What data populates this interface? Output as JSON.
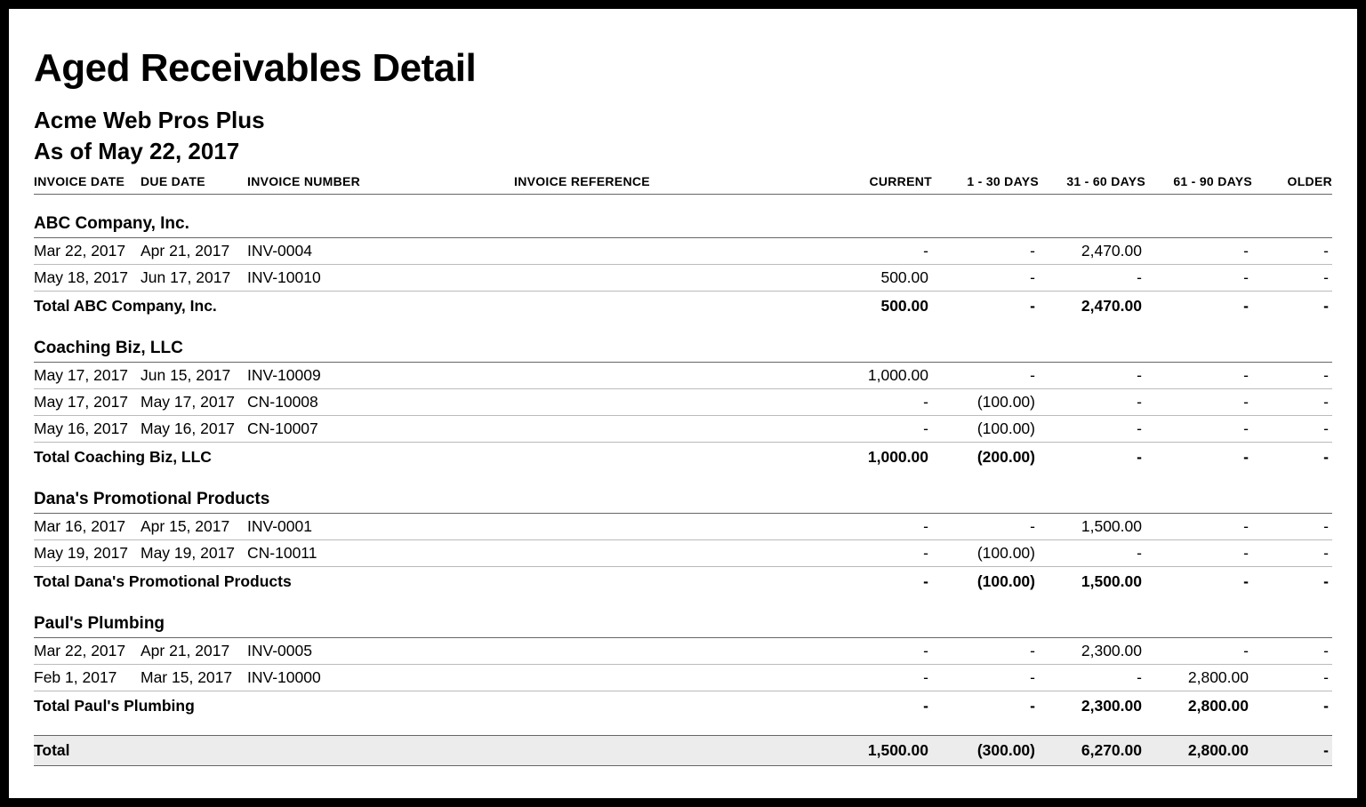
{
  "title": "Aged Receivables Detail",
  "company": "Acme Web Pros Plus",
  "as_of": "As of May 22, 2017",
  "columns": {
    "invoice_date": "INVOICE DATE",
    "due_date": "DUE DATE",
    "invoice_number": "INVOICE NUMBER",
    "invoice_reference": "INVOICE REFERENCE",
    "current": "CURRENT",
    "d1_30": "1 - 30 DAYS",
    "d31_60": "31 - 60 DAYS",
    "d61_90": "61 - 90 DAYS",
    "older": "OLDER"
  },
  "sections": [
    {
      "name": "ABC Company, Inc.",
      "rows": [
        {
          "invoice_date": "Mar 22, 2017",
          "due_date": "Apr 21, 2017",
          "invoice_number": "INV-0004",
          "invoice_reference": "",
          "current": "-",
          "d1_30": "-",
          "d31_60": "2,470.00",
          "d61_90": "-",
          "older": "-"
        },
        {
          "invoice_date": "May 18, 2017",
          "due_date": "Jun 17, 2017",
          "invoice_number": "INV-10010",
          "invoice_reference": "",
          "current": "500.00",
          "d1_30": "-",
          "d31_60": "-",
          "d61_90": "-",
          "older": "-"
        }
      ],
      "total": {
        "label": "Total ABC Company, Inc.",
        "current": "500.00",
        "d1_30": "-",
        "d31_60": "2,470.00",
        "d61_90": "-",
        "older": "-"
      }
    },
    {
      "name": "Coaching Biz, LLC",
      "rows": [
        {
          "invoice_date": "May 17, 2017",
          "due_date": "Jun 15, 2017",
          "invoice_number": "INV-10009",
          "invoice_reference": "",
          "current": "1,000.00",
          "d1_30": "-",
          "d31_60": "-",
          "d61_90": "-",
          "older": "-"
        },
        {
          "invoice_date": "May 17, 2017",
          "due_date": "May 17, 2017",
          "invoice_number": "CN-10008",
          "invoice_reference": "",
          "current": "-",
          "d1_30": "(100.00)",
          "d31_60": "-",
          "d61_90": "-",
          "older": "-"
        },
        {
          "invoice_date": "May 16, 2017",
          "due_date": "May 16, 2017",
          "invoice_number": "CN-10007",
          "invoice_reference": "",
          "current": "-",
          "d1_30": "(100.00)",
          "d31_60": "-",
          "d61_90": "-",
          "older": "-"
        }
      ],
      "total": {
        "label": "Total Coaching Biz, LLC",
        "current": "1,000.00",
        "d1_30": "(200.00)",
        "d31_60": "-",
        "d61_90": "-",
        "older": "-"
      }
    },
    {
      "name": "Dana's Promotional Products",
      "rows": [
        {
          "invoice_date": "Mar 16, 2017",
          "due_date": "Apr 15, 2017",
          "invoice_number": "INV-0001",
          "invoice_reference": "",
          "current": "-",
          "d1_30": "-",
          "d31_60": "1,500.00",
          "d61_90": "-",
          "older": "-"
        },
        {
          "invoice_date": "May 19, 2017",
          "due_date": "May 19, 2017",
          "invoice_number": "CN-10011",
          "invoice_reference": "",
          "current": "-",
          "d1_30": "(100.00)",
          "d31_60": "-",
          "d61_90": "-",
          "older": "-"
        }
      ],
      "total": {
        "label": "Total Dana's Promotional Products",
        "current": "-",
        "d1_30": "(100.00)",
        "d31_60": "1,500.00",
        "d61_90": "-",
        "older": "-"
      }
    },
    {
      "name": "Paul's Plumbing",
      "rows": [
        {
          "invoice_date": "Mar 22, 2017",
          "due_date": "Apr 21, 2017",
          "invoice_number": "INV-0005",
          "invoice_reference": "",
          "current": "-",
          "d1_30": "-",
          "d31_60": "2,300.00",
          "d61_90": "-",
          "older": "-"
        },
        {
          "invoice_date": "Feb 1, 2017",
          "due_date": "Mar 15, 2017",
          "invoice_number": "INV-10000",
          "invoice_reference": "",
          "current": "-",
          "d1_30": "-",
          "d31_60": "-",
          "d61_90": "2,800.00",
          "older": "-"
        }
      ],
      "total": {
        "label": "Total Paul's Plumbing",
        "current": "-",
        "d1_30": "-",
        "d31_60": "2,300.00",
        "d61_90": "2,800.00",
        "older": "-"
      }
    }
  ],
  "grand_total": {
    "label": "Total",
    "current": "1,500.00",
    "d1_30": "(300.00)",
    "d31_60": "6,270.00",
    "d61_90": "2,800.00",
    "older": "-"
  }
}
